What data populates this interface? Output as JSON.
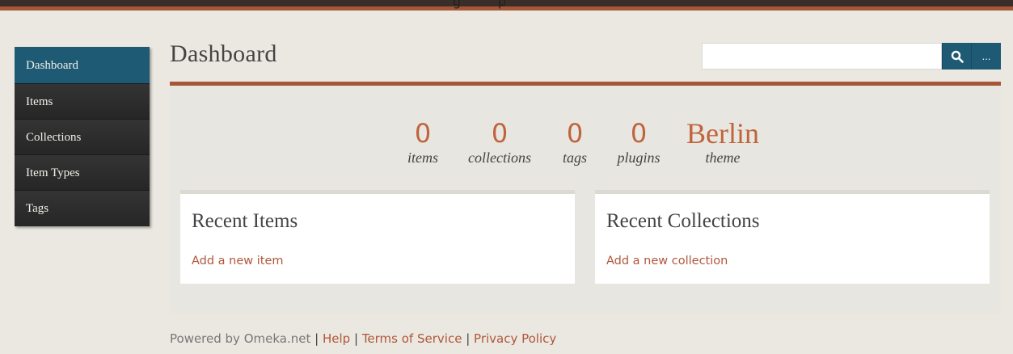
{
  "header": {
    "title_fragment": "g         p"
  },
  "sidebar": {
    "items": [
      {
        "label": "Dashboard",
        "active": true
      },
      {
        "label": "Items"
      },
      {
        "label": "Collections"
      },
      {
        "label": "Item Types"
      },
      {
        "label": "Tags"
      }
    ]
  },
  "page": {
    "title": "Dashboard"
  },
  "search": {
    "value": "",
    "search_icon": "search-icon",
    "more_label": "..."
  },
  "stats": [
    {
      "value": "0",
      "label": "items"
    },
    {
      "value": "0",
      "label": "collections"
    },
    {
      "value": "0",
      "label": "tags"
    },
    {
      "value": "0",
      "label": "plugins"
    },
    {
      "value": "Berlin",
      "label": "theme"
    }
  ],
  "recent_items": {
    "heading": "Recent Items",
    "link": "Add a new item"
  },
  "recent_collections": {
    "heading": "Recent Collections",
    "link": "Add a new collection"
  },
  "footer": {
    "powered_by": "Powered by Omeka.net",
    "separator": "|",
    "links": [
      "Help",
      "Terms of Service",
      "Privacy Policy"
    ]
  },
  "colors": {
    "accent": "#a65738",
    "nav_active": "#1e5a74",
    "link": "#b0563a",
    "stat": "#c0643d"
  }
}
